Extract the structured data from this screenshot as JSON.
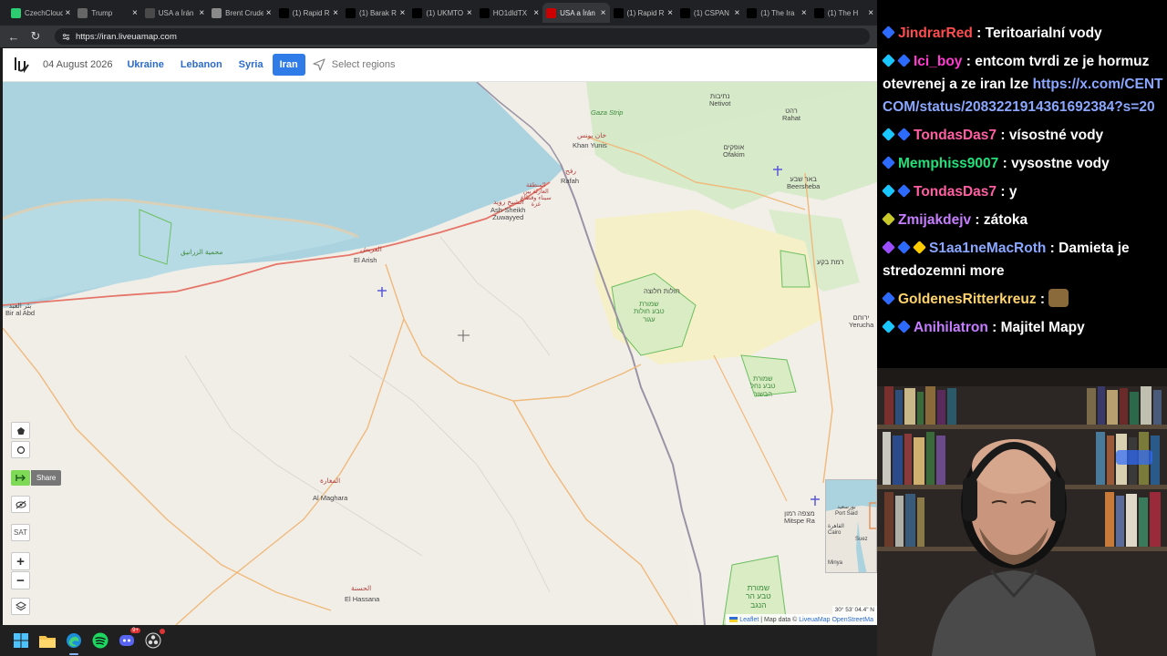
{
  "browser": {
    "tabs": [
      {
        "label": "CzechCloud",
        "icon": "green-x-icon",
        "color": "#2ecc71",
        "active": false
      },
      {
        "label": "Trump",
        "icon": "youtube-icon",
        "color": "#666666",
        "active": false
      },
      {
        "label": "USA a Írán",
        "icon": "news-icon",
        "color": "#4a4a4a",
        "active": false
      },
      {
        "label": "Brent Crude",
        "icon": "globe-icon",
        "color": "#8a8a8a",
        "active": false
      },
      {
        "label": "(1) Rapid R",
        "icon": "x-icon",
        "color": "#000000",
        "active": false
      },
      {
        "label": "(1) Barak R",
        "icon": "x-icon",
        "color": "#000000",
        "active": false
      },
      {
        "label": "(1) UKMTO",
        "icon": "x-icon",
        "color": "#000000",
        "active": false
      },
      {
        "label": "HO1dldTX",
        "icon": "x-icon",
        "color": "#000000",
        "active": false
      },
      {
        "label": "USA a Írán",
        "icon": "seznam-icon",
        "color": "#cc0000",
        "active": true
      },
      {
        "label": "(1) Rapid R",
        "icon": "x-icon",
        "color": "#000000",
        "active": false
      },
      {
        "label": "(1) CSPAN",
        "icon": "x-icon",
        "color": "#000000",
        "active": false
      },
      {
        "label": "(1) The Ira",
        "icon": "x-icon",
        "color": "#000000",
        "active": false
      },
      {
        "label": "(1) The H",
        "icon": "x-icon",
        "color": "#000000",
        "active": false
      }
    ],
    "url": "https://iran.liveuamap.com"
  },
  "header": {
    "date": "04 August 2026",
    "regions": [
      {
        "label": "Ukraine",
        "active": false
      },
      {
        "label": "Lebanon",
        "active": false
      },
      {
        "label": "Syria",
        "active": false
      },
      {
        "label": "Iran",
        "active": true
      }
    ],
    "select_regions": "Select regions"
  },
  "map": {
    "labels": {
      "khan_yunis_ar": "خان يونس",
      "khan_yunis": "Khan Yunis",
      "rafah_ar": "رفح",
      "rafah": "Rafah",
      "gaza_strip": "Gaza Strip",
      "netivot": "נתיבות\nNetivot",
      "ofakim": "אופקים\nOfakim",
      "rahat": "רהט\nRahat",
      "beersheba": "באר שבע\nBeersheba",
      "sinai_ar": "المنطقة\nالعازلة بين\nسيناء وقطاع\nغزة",
      "sheikh_zuwayed_ar": "الشيخ زويد",
      "sheikh_zuwayed": "Ash-Sheikh\nZuwayyed",
      "el_arish_ar": "العريش",
      "el_arish": "El Arish",
      "zaranik": "محمية الزرانيق",
      "bir_al_abd": "بئر العبد\nBir al Abd",
      "halutza": "חולות חלוצה",
      "reserve_halutza": "שמורת\nטבע חולות\nעגור",
      "rotem": "רמת בקע",
      "yeruham": "ירוחם\nYerucha",
      "reserve_mashabe": "שמורת\nטבע נחל\nהבשור",
      "al_maghara_ar": "المغارة",
      "al_maghara": "Al Maghara",
      "mitspe_ramon": "מצפה רמון\nMitspe Ra",
      "el_hassana_ar": "الحسنة",
      "el_hassana": "El Hassana",
      "negev_reserve": "שמורת\nטבע הר\nהנגב"
    },
    "controls": {
      "share_label": "Share",
      "sat_label": "SAT",
      "zoom_in": "+",
      "zoom_out": "−"
    },
    "minimap_labels": {
      "port_said": "بورسعيد\nPort Said",
      "cairo": "القاهرة\nCairo",
      "suez": "Suez",
      "minya": "Minya"
    },
    "coordinates": "30° 53' 04.4\" N",
    "attribution": {
      "leaflet": "Leaflet",
      "map_data": "| Map data ©",
      "liveuamap": "LiveuaMap",
      "osm": "OpenStreetMa"
    }
  },
  "chat": {
    "messages": [
      {
        "user": "JindrarRed",
        "color": "#ff4d4d",
        "badges": [
          "#2d6bff"
        ],
        "text": "Teritoarialní vody"
      },
      {
        "user": "Ici_boy",
        "color": "#ff3bd1",
        "badges": [
          "#19c6ff",
          "#2d6bff"
        ],
        "text": "entcom tvrdi ze je hormuz otevrenej a ze iran lze",
        "link": "https://x.com/CENTCOM/status/2083221914361692384?s=20"
      },
      {
        "user": "TondasDas7",
        "color": "#ff5fa2",
        "badges": [
          "#19c6ff",
          "#2d6bff"
        ],
        "text": "vísostné vody"
      },
      {
        "user": "Memphiss9007",
        "color": "#22e07a",
        "badges": [
          "#2d6bff"
        ],
        "text": "vysostne vody"
      },
      {
        "user": "TondasDas7",
        "color": "#ff5fa2",
        "badges": [
          "#19c6ff",
          "#2d6bff"
        ],
        "text": "y"
      },
      {
        "user": "Zmijakdejv",
        "color": "#c77dff",
        "badges": [
          "#c8c828"
        ],
        "text": "zátoka"
      },
      {
        "user": "S1aa1neMacRoth",
        "color": "#8aa7ff",
        "badges": [
          "#9b4dff",
          "#2d6bff",
          "#ffcc00"
        ],
        "text": "Damieta je stredozemni more"
      },
      {
        "user": "GoldenesRitterkreuz",
        "color": "#ffd36b",
        "badges": [
          "#2d6bff"
        ],
        "text": "",
        "emote": true
      },
      {
        "user": "Anihilatron",
        "color": "#c77dff",
        "badges": [
          "#19c6ff",
          "#2d6bff"
        ],
        "text": "Majitel Mapy"
      }
    ]
  },
  "taskbar": {
    "apps": [
      "windows-start-icon",
      "file-explorer-icon",
      "edge-browser-icon",
      "spotify-icon",
      "discord-icon",
      "obs-icon"
    ],
    "discord_badge": "9+"
  }
}
